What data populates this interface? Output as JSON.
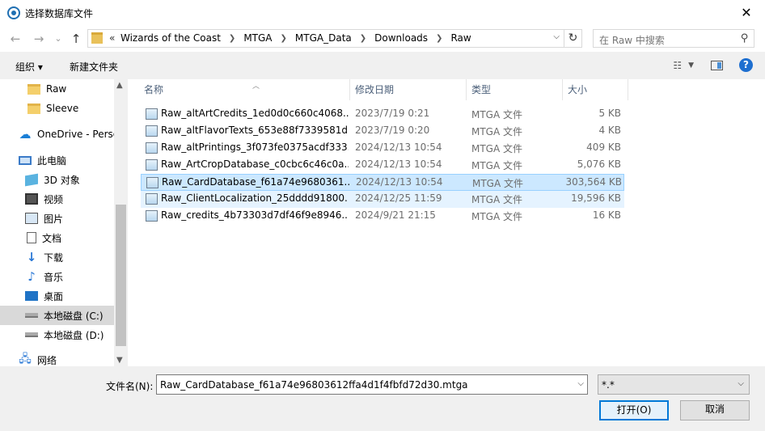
{
  "window": {
    "title": "选择数据库文件"
  },
  "nav": {
    "back": "←",
    "forward": "→",
    "recent": "⌄",
    "up": "↑",
    "breadcrumb_prefix": "«",
    "breadcrumbs": [
      "Wizards of the Coast",
      "MTGA",
      "MTGA_Data",
      "Downloads",
      "Raw"
    ],
    "search_placeholder": "在 Raw 中搜索"
  },
  "toolbar": {
    "organize": "组织 ▾",
    "new_folder": "新建文件夹"
  },
  "sidebar": {
    "items": [
      {
        "label": "Raw",
        "icon": "folder-icon"
      },
      {
        "label": "Sleeve",
        "icon": "folder-icon"
      },
      {
        "label": "OneDrive - Perso",
        "icon": "cloud-icon"
      },
      {
        "label": "此电脑",
        "icon": "computer-icon"
      },
      {
        "label": "3D 对象",
        "icon": "cube-icon"
      },
      {
        "label": "视频",
        "icon": "video-icon"
      },
      {
        "label": "图片",
        "icon": "picture-icon"
      },
      {
        "label": "文档",
        "icon": "document-icon"
      },
      {
        "label": "下载",
        "icon": "download-icon"
      },
      {
        "label": "音乐",
        "icon": "music-icon"
      },
      {
        "label": "桌面",
        "icon": "desktop-icon"
      },
      {
        "label": "本地磁盘 (C:)",
        "icon": "drive-icon",
        "selected": true
      },
      {
        "label": "本地磁盘 (D:)",
        "icon": "drive-icon"
      },
      {
        "label": "网络",
        "icon": "network-icon"
      }
    ]
  },
  "columns": {
    "name": "名称",
    "date": "修改日期",
    "type": "类型",
    "size": "大小"
  },
  "files": [
    {
      "name": "Raw_altArtCredits_1ed0d0c660c4068...",
      "date": "2023/7/19 0:21",
      "type": "MTGA 文件",
      "size": "5 KB"
    },
    {
      "name": "Raw_altFlavorTexts_653e88f7339581d...",
      "date": "2023/7/19 0:20",
      "type": "MTGA 文件",
      "size": "4 KB"
    },
    {
      "name": "Raw_altPrintings_3f073fe0375acdf333...",
      "date": "2024/12/13 10:54",
      "type": "MTGA 文件",
      "size": "409 KB"
    },
    {
      "name": "Raw_ArtCropDatabase_c0cbc6c46c0a...",
      "date": "2024/12/13 10:54",
      "type": "MTGA 文件",
      "size": "5,076 KB"
    },
    {
      "name": "Raw_CardDatabase_f61a74e9680361...",
      "date": "2024/12/13 10:54",
      "type": "MTGA 文件",
      "size": "303,564 KB",
      "state": "selected"
    },
    {
      "name": "Raw_ClientLocalization_25dddd91800...",
      "date": "2024/12/25 11:59",
      "type": "MTGA 文件",
      "size": "19,596 KB",
      "state": "hover"
    },
    {
      "name": "Raw_credits_4b73303d7df46f9e8946...",
      "date": "2024/9/21 21:15",
      "type": "MTGA 文件",
      "size": "16 KB"
    }
  ],
  "footer": {
    "filename_label": "文件名(N):",
    "filename_value": "Raw_CardDatabase_f61a74e96803612ffa4d1f4fbfd72d30.mtga",
    "filetype_value": "*.*",
    "open_button": "打开(O)",
    "cancel_button": "取消"
  },
  "colors": {
    "accent": "#0078d7",
    "selection": "#cce8ff",
    "hover": "#e5f3ff"
  }
}
